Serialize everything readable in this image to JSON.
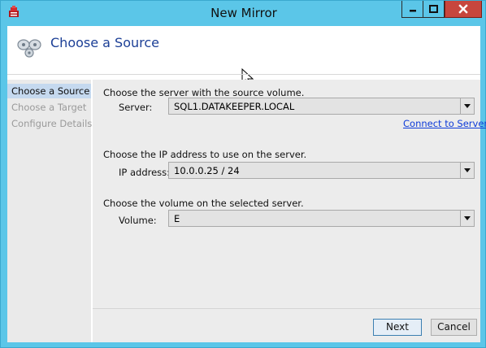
{
  "window": {
    "title": "New Mirror"
  },
  "header": {
    "title": "Choose a Source"
  },
  "sidebar": {
    "items": [
      {
        "label": "Choose a Source",
        "active": true
      },
      {
        "label": "Choose a Target",
        "active": false
      },
      {
        "label": "Configure Details",
        "active": false
      }
    ]
  },
  "main": {
    "server_prompt": "Choose the server with the source volume.",
    "server_label": "Server:",
    "server_value": "SQL1.DATAKEEPER.LOCAL",
    "connect_link": "Connect to Server",
    "ip_prompt": "Choose the IP address to use on the server.",
    "ip_label": "IP address:",
    "ip_value": "10.0.0.25 / 24",
    "volume_prompt": "Choose the volume on the selected server.",
    "volume_label": "Volume:",
    "volume_value": "E"
  },
  "buttons": {
    "next": "Next",
    "cancel": "Cancel"
  },
  "colors": {
    "titlebar": "#5bc6e8",
    "close": "#c7463d",
    "header_title": "#1c3f96",
    "active_nav": "#c5d9ef",
    "link": "#0d3ad8"
  },
  "icons": [
    "app-icon",
    "minimize-icon",
    "maximize-icon",
    "close-icon",
    "mirror-wizard-icon",
    "mouse-cursor",
    "dropdown-arrow-icon"
  ]
}
